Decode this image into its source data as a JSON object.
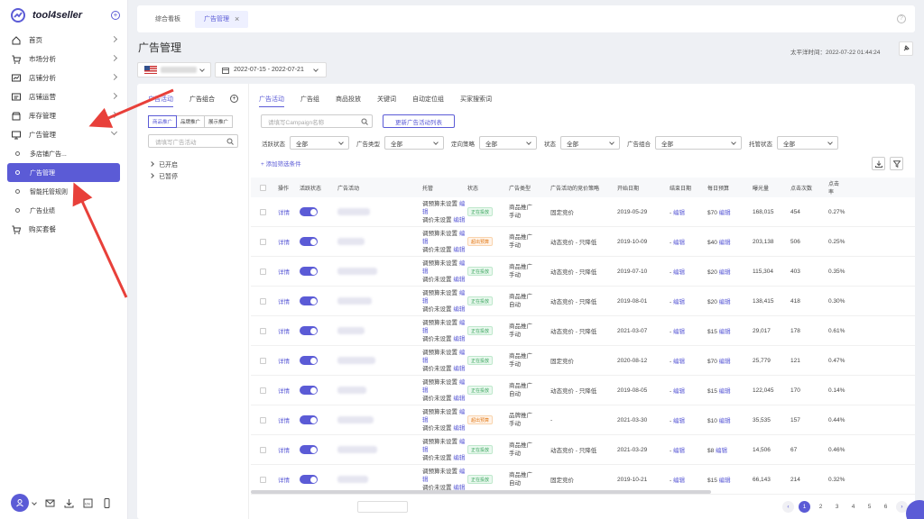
{
  "app": {
    "logo": "tool4seller"
  },
  "sidebar": {
    "items": [
      {
        "label": "首页",
        "icon": "home-icon"
      },
      {
        "label": "市场分析",
        "icon": "cart-icon"
      },
      {
        "label": "店铺分析",
        "icon": "chart-icon"
      },
      {
        "label": "店铺运营",
        "icon": "doc-icon"
      },
      {
        "label": "库存管理",
        "icon": "box-icon"
      },
      {
        "label": "广告管理",
        "icon": "monitor-icon"
      }
    ],
    "ad_sub": [
      {
        "label": "多店铺广告..."
      },
      {
        "label": "广告管理"
      },
      {
        "label": "智能托管规则"
      },
      {
        "label": "广告业绩"
      }
    ],
    "buy": "购买套餐"
  },
  "tabs": [
    {
      "label": "综合看板"
    },
    {
      "label": "广告管理"
    }
  ],
  "header": {
    "title": "广告管理",
    "timezone": "太平洋时间：2022-07-22 01:44:24",
    "date_range": "2022-07-15 - 2022-07-21"
  },
  "left_panel": {
    "tabs": [
      "广告活动",
      "广告组合"
    ],
    "segments": [
      "商品推广",
      "品牌推广",
      "展示推广"
    ],
    "search_placeholder": "请填写广告活动",
    "tree": [
      "已开启",
      "已暂停"
    ]
  },
  "main": {
    "tabs": [
      "广告活动",
      "广告组",
      "商品投放",
      "关键词",
      "自动定位组",
      "买家搜索词"
    ],
    "search_placeholder": "请填写Campaign名称",
    "update_button": "更新广告活动列表",
    "filters": [
      {
        "label": "活跃状态",
        "value": "全部"
      },
      {
        "label": "广告类型",
        "value": "全部"
      },
      {
        "label": "定向策略",
        "value": "全部"
      },
      {
        "label": "状态",
        "value": "全部"
      },
      {
        "label": "广告组合",
        "value": "全部"
      },
      {
        "label": "托管状态",
        "value": "全部"
      }
    ],
    "add_filter": "+ 添加筛选条件"
  },
  "table": {
    "headers": [
      "操作",
      "活跃状态",
      "广告活动",
      "托管",
      "状态",
      "广告类型",
      "广告活动的竞价策略",
      "开始日期",
      "结束日期",
      "每日预算",
      "曝光量",
      "点击次数",
      "点击率"
    ],
    "budget_line": "调预算未设置",
    "price_line": "调价未设置",
    "edit": "编辑",
    "detail": "详情",
    "rows": [
      {
        "status": "正在投放",
        "status_kind": "on",
        "type1": "商品推广",
        "type2": "手动",
        "strategy": "固定竞价",
        "start": "2019-05-29",
        "end": "-",
        "budget": "$70",
        "impr": "168,015",
        "clicks": "454",
        "ctr": "0.27%"
      },
      {
        "status": "超出预算",
        "status_kind": "off",
        "type1": "商品推广",
        "type2": "手动",
        "strategy": "动态竞价 - 只降低",
        "start": "2019-10-09",
        "end": "-",
        "budget": "$40",
        "impr": "203,138",
        "clicks": "506",
        "ctr": "0.25%"
      },
      {
        "status": "正在投放",
        "status_kind": "on",
        "type1": "商品推广",
        "type2": "手动",
        "strategy": "动态竞价 - 只降低",
        "start": "2019-07-10",
        "end": "-",
        "budget": "$20",
        "impr": "115,304",
        "clicks": "403",
        "ctr": "0.35%"
      },
      {
        "status": "正在投放",
        "status_kind": "on",
        "type1": "商品推广",
        "type2": "自动",
        "strategy": "动态竞价 - 只降低",
        "start": "2019-08-01",
        "end": "-",
        "budget": "$20",
        "impr": "138,415",
        "clicks": "418",
        "ctr": "0.30%"
      },
      {
        "status": "正在投放",
        "status_kind": "on",
        "type1": "商品推广",
        "type2": "手动",
        "strategy": "动态竞价 - 只降低",
        "start": "2021-03-07",
        "end": "-",
        "budget": "$15",
        "impr": "29,017",
        "clicks": "178",
        "ctr": "0.61%"
      },
      {
        "status": "正在投放",
        "status_kind": "on",
        "type1": "商品推广",
        "type2": "手动",
        "strategy": "固定竞价",
        "start": "2020-08-12",
        "end": "-",
        "budget": "$70",
        "impr": "25,779",
        "clicks": "121",
        "ctr": "0.47%"
      },
      {
        "status": "正在投放",
        "status_kind": "on",
        "type1": "商品推广",
        "type2": "自动",
        "strategy": "动态竞价 - 只降低",
        "start": "2019-08-05",
        "end": "-",
        "budget": "$15",
        "impr": "122,045",
        "clicks": "170",
        "ctr": "0.14%"
      },
      {
        "status": "超出预算",
        "status_kind": "off",
        "type1": "品牌推广",
        "type2": "手动",
        "strategy": "-",
        "start": "2021-03-30",
        "end": "-",
        "budget": "$10",
        "impr": "35,535",
        "clicks": "157",
        "ctr": "0.44%"
      },
      {
        "status": "正在投放",
        "status_kind": "on",
        "type1": "商品推广",
        "type2": "手动",
        "strategy": "动态竞价 - 只降低",
        "start": "2021-03-29",
        "end": "-",
        "budget": "$8",
        "impr": "14,506",
        "clicks": "67",
        "ctr": "0.46%"
      },
      {
        "status": "正在投放",
        "status_kind": "on",
        "type1": "商品推广",
        "type2": "自动",
        "strategy": "固定竞价",
        "start": "2019-10-21",
        "end": "-",
        "budget": "$15",
        "impr": "66,143",
        "clicks": "214",
        "ctr": "0.32%"
      }
    ]
  },
  "pagination": {
    "pages": [
      "1",
      "2",
      "3",
      "4",
      "5",
      "6"
    ],
    "current": "1"
  },
  "colors": {
    "accent": "#5b5bd6",
    "arrow": "#e8403a",
    "status_on": "#35a35a",
    "status_off": "#e27a18"
  }
}
